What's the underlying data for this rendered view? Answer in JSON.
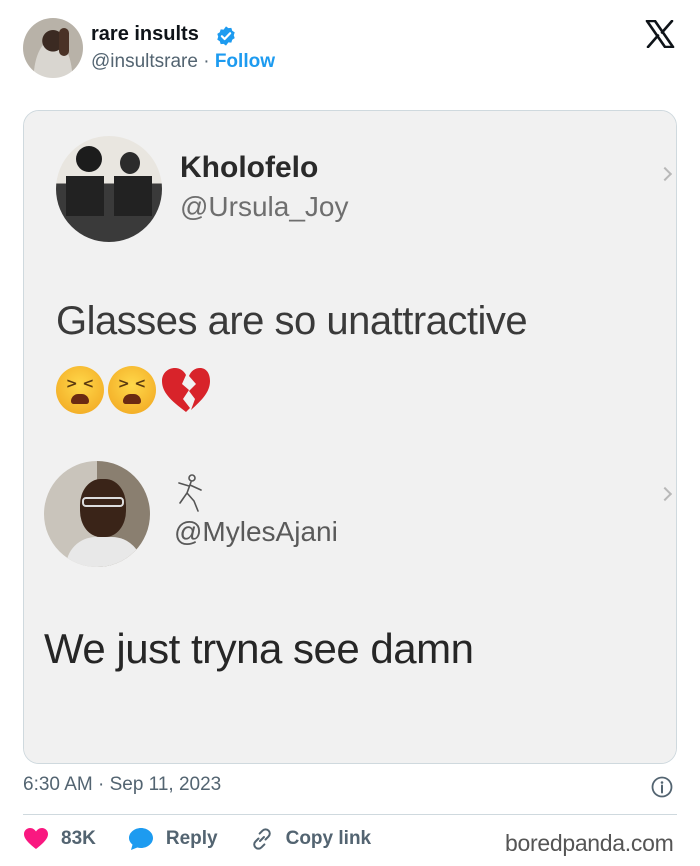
{
  "header": {
    "author_name": "rare insults",
    "handle": "@insultsrare",
    "separator": "·",
    "follow_label": "Follow",
    "verified_icon": "verified-badge-icon",
    "verified_color": "#1d9bf0",
    "logo_icon": "x-logo-icon"
  },
  "quoted": {
    "first": {
      "name": "Kholofelo",
      "handle": "@Ursula_Joy",
      "text": "Glasses are so unattractive",
      "emojis": [
        "tired-face-icon",
        "tired-face-icon",
        "broken-heart-icon"
      ]
    },
    "reply": {
      "name_icon": "dancer-icon",
      "handle": "@MylesAjani",
      "text": "We just tryna see damn"
    }
  },
  "footer": {
    "timestamp": "6:30 AM · Sep 11, 2023",
    "like_count": "83K",
    "reply_label": "Reply",
    "copy_label": "Copy link",
    "like_color": "#f91880",
    "reply_color": "#1d9bf0"
  },
  "watermark": "boredpanda.com"
}
